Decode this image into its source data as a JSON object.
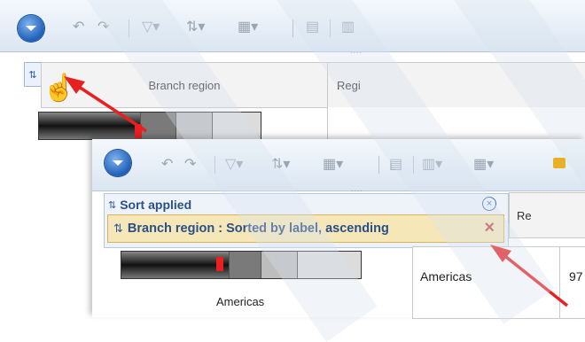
{
  "back_window": {
    "toolbar_dots": "....",
    "column_headers": [
      "Branch region",
      "Regi"
    ]
  },
  "front_window": {
    "toolbar_dots": "....",
    "sort_panel": {
      "title": "Sort applied",
      "item": "Branch region : Sorted by label, ascending"
    },
    "column_header_partial": "Re",
    "row": {
      "label": "Americas",
      "value_partial": "97"
    }
  },
  "back_window_bottom_text": "Americas",
  "colors": {
    "accent_red": "#e8201f",
    "sort_item_bg": "#f6e7b9",
    "toolbar_blue": "#1f5fb8"
  },
  "icons": [
    "orb-menu-icon",
    "undo-icon",
    "redo-icon",
    "filter-icon",
    "sort-icon",
    "top-bottom-icon",
    "table-icon",
    "chart-icon",
    "close-icon",
    "remove-icon",
    "pointer-hand-icon"
  ]
}
